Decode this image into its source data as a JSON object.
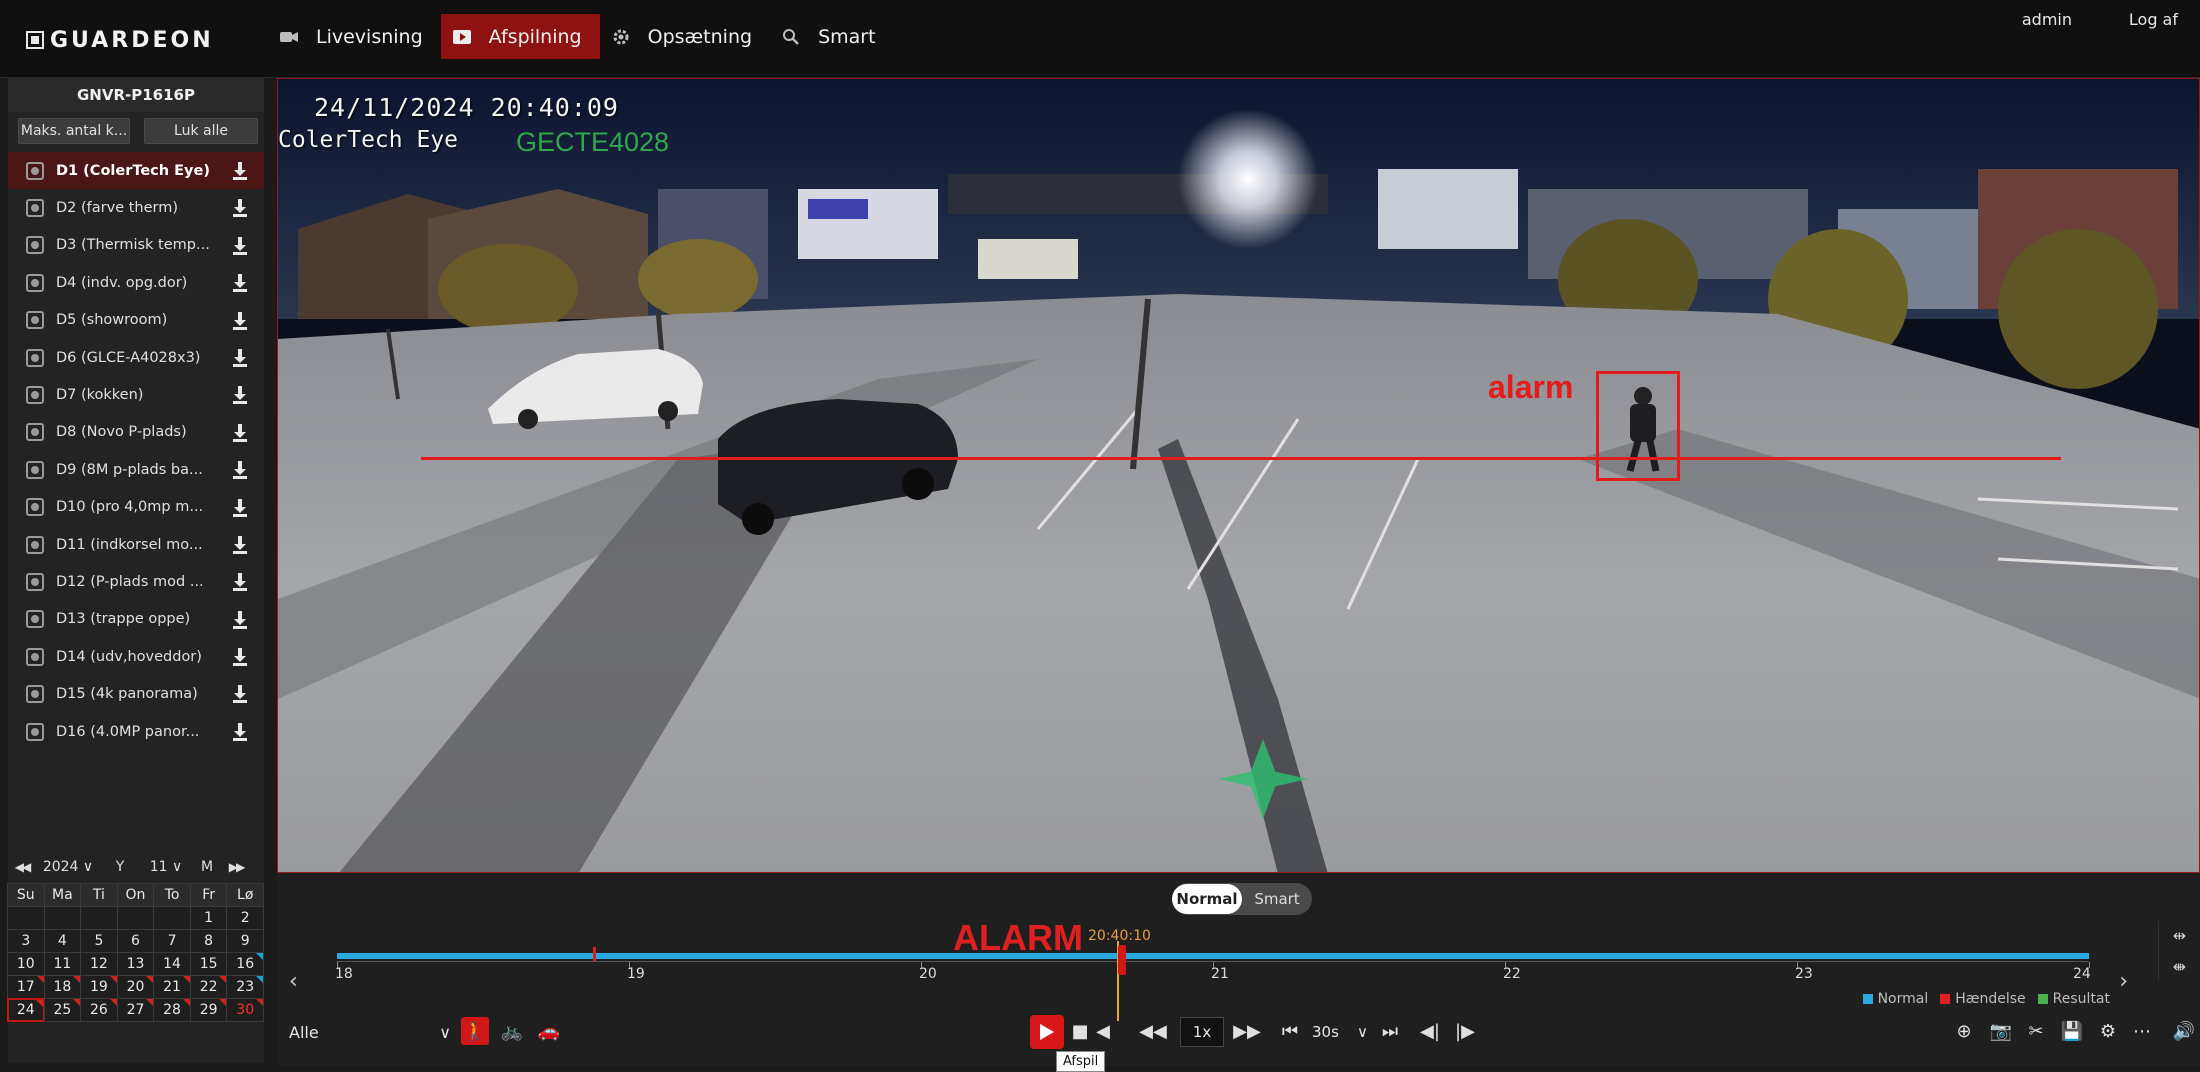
{
  "brand": "GUARDEON",
  "nav": [
    {
      "label": "Livevisning",
      "icon": "camera-icon"
    },
    {
      "label": "Afspilning",
      "icon": "play-icon"
    },
    {
      "label": "Opsætning",
      "icon": "gear-icon"
    },
    {
      "label": "Smart",
      "icon": "search-icon"
    }
  ],
  "user": "admin",
  "logout": "Log af",
  "device": "GNVR-P1616P",
  "sidebar_buttons": {
    "max": "Maks. antal k...",
    "close_all": "Luk alle"
  },
  "channels": [
    "D1 (ColerTech Eye)",
    "D2 (farve therm)",
    "D3 (Thermisk temp...",
    "D4 (indv. opg.dor)",
    "D5 (showroom)",
    "D6 (GLCE-A4028x3)",
    "D7 (kokken)",
    "D8 (Novo P-plads)",
    "D9 (8M p-plads ba...",
    "D10 (pro 4,0mp m...",
    "D11 (indkorsel mo...",
    "D12 (P-plads mod ...",
    "D13 (trappe oppe)",
    "D14 (udv,hoveddor)",
    "D15 (4k panorama)",
    "D16 (4.0MP panor..."
  ],
  "calendar": {
    "year": "2024",
    "year_label": "Y",
    "month": "11",
    "month_label": "M",
    "weekdays": [
      "Su",
      "Ma",
      "Ti",
      "On",
      "To",
      "Fr",
      "Lø"
    ],
    "days": [
      "",
      "",
      "",
      "",
      "",
      "1",
      "2",
      "3",
      "4",
      "5",
      "6",
      "7",
      "8",
      "9",
      "10",
      "11",
      "12",
      "13",
      "14",
      "15",
      "16",
      "17",
      "18",
      "19",
      "20",
      "21",
      "22",
      "23",
      "24",
      "25",
      "26",
      "27",
      "28",
      "29",
      "30"
    ],
    "today": "24",
    "selected": "30"
  },
  "osd": {
    "datetime": "24/11/2024 20:40:09",
    "camera": "ColerTech Eye",
    "model": "GECTE4028"
  },
  "alarm_label": "alarm",
  "timeline": {
    "modes": [
      "Normal",
      "Smart"
    ],
    "alarm": "ALARM",
    "current_time": "20:40:10",
    "hours": [
      "18",
      "19",
      "20",
      "21",
      "22",
      "23",
      "24"
    ],
    "legend": [
      {
        "label": "Normal",
        "color": "#2aa9e0"
      },
      {
        "label": "Hændelse",
        "color": "#e02020"
      },
      {
        "label": "Resultat",
        "color": "#4caf50"
      }
    ]
  },
  "controls": {
    "filter": "Alle",
    "speed": "1x",
    "step": "30s",
    "tooltip": "Afspil"
  }
}
